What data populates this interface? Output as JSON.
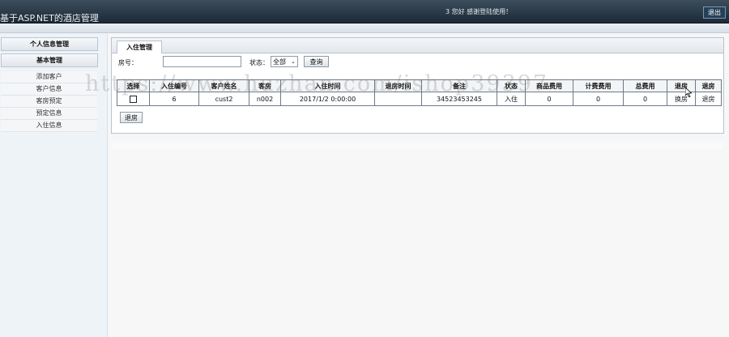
{
  "header": {
    "app_title": "基于ASP.NET的酒店管理",
    "welcome": "3 您好 感谢登陆使用！",
    "logout_label": "退出"
  },
  "sidebar": {
    "section_personal": "个人信息管理",
    "section_basic": "基本管理",
    "items": [
      {
        "label": "添加客户"
      },
      {
        "label": "客户信息"
      },
      {
        "label": "客房预定"
      },
      {
        "label": "预定信息"
      },
      {
        "label": "入住信息"
      }
    ]
  },
  "main": {
    "tab_label": "入住管理",
    "room_label": "房号：",
    "room_value": "",
    "status_label": "状态：",
    "status_selected": "全部",
    "search_button": "查询",
    "checkout_button": "退房"
  },
  "table": {
    "headers": [
      "选择",
      "入住编号",
      "客户姓名",
      "客房",
      "入住时间",
      "退房时间",
      "备注",
      "状态",
      "商品费用",
      "计费费用",
      "总费用",
      "退房",
      "退房"
    ],
    "rows": [
      {
        "id": "6",
        "customer": "cust2",
        "room": "n002",
        "checkin": "2017/1/2 0:00:00",
        "checkout": "",
        "remark": "34523453245",
        "status": "入住",
        "goods_fee": "0",
        "billing_fee": "0",
        "total_fee": "0",
        "action1": "换房",
        "action2": "退房"
      }
    ]
  },
  "watermark": "https://www.huzhan.com/ishop39397"
}
